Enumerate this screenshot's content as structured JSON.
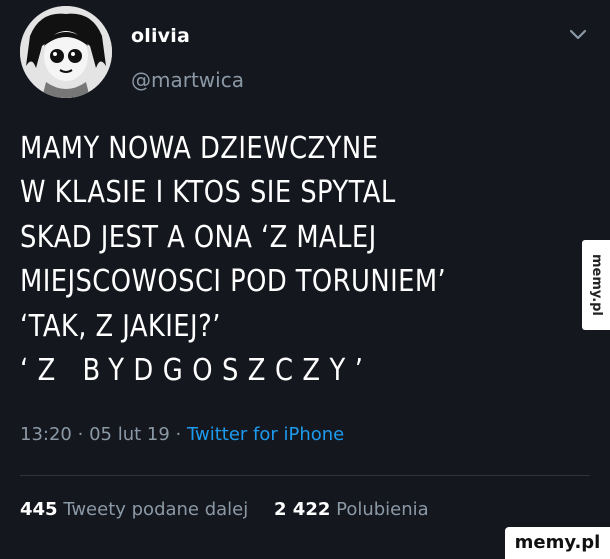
{
  "author": {
    "display_name": "olivia",
    "handle": "@martwica"
  },
  "tweet": {
    "lines": [
      "MAMY NOWA DZIEWCZYNE",
      "W KLASIE I KTOS SIE SPYTAL",
      "SKAD JEST A ONA ‘Z MALEJ",
      "MIEJSCOWOSCI POD TORUNIEM’",
      "‘TAK, Z JAKIEJ?’",
      "‘Z BYDGOSZCZY’"
    ],
    "time": "13:20",
    "date": "05 lut 19",
    "source": "Twitter for iPhone"
  },
  "stats": {
    "retweets_count": "445",
    "retweets_label": "Tweety podane dalej",
    "likes_count": "2 422",
    "likes_label": "Polubienia"
  },
  "watermarks": {
    "side": "memy.pl",
    "corner": "memy.pl"
  },
  "icons": {
    "menu": "chevron-down-icon",
    "avatar": "avatar-image"
  },
  "colors": {
    "background": "#14171e",
    "text": "#ffffff",
    "secondary": "#8b98a5",
    "link": "#1d9bf0"
  }
}
